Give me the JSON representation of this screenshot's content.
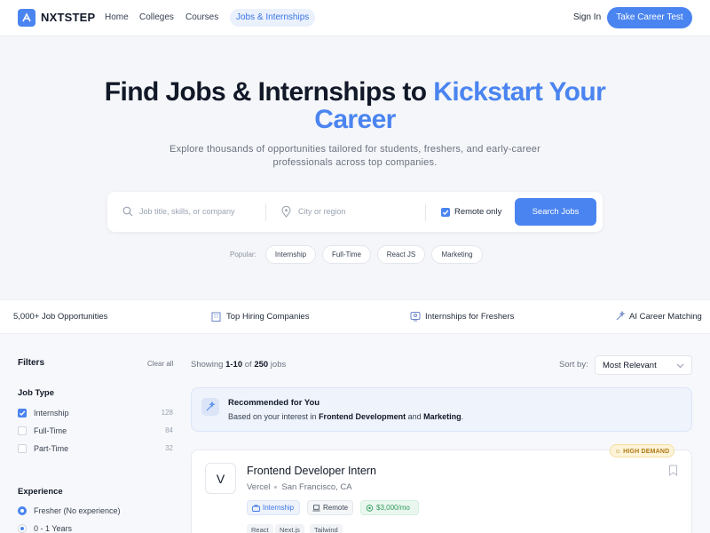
{
  "nav": {
    "brand": "NXTSTEP",
    "links": [
      "Home",
      "Colleges",
      "Courses",
      "Jobs & Internships"
    ],
    "active_link": "Jobs & Internships",
    "signin": "Sign In",
    "cta": "Take Career Test",
    "accent_color": "#4a84f0"
  },
  "hero": {
    "title_part1": "Find Jobs & Internships to ",
    "title_accent_1": "Kickstart Your",
    "title_accent_2": "Career",
    "subtitle": "Explore thousands of opportunities tailored for students, freshers, and early-career professionals across top companies."
  },
  "search": {
    "job_placeholder": "Job title, skills, or company",
    "location_placeholder": "City or region",
    "remote_label": "Remote only",
    "remote_checked": true,
    "button": "Search Jobs",
    "popular_label": "Popular:",
    "popular_tags": [
      "Internship",
      "Full-Time",
      "React JS",
      "Marketing"
    ]
  },
  "features": [
    {
      "label": "5,000+ Job Opportunities",
      "icon": "briefcase-icon"
    },
    {
      "label": "Top Hiring Companies",
      "icon": "building-icon"
    },
    {
      "label": "Internships for Freshers",
      "icon": "id-card-icon"
    },
    {
      "label": "AI Career Matching",
      "icon": "sparkle-icon"
    }
  ],
  "filters": {
    "title": "Filters",
    "clear": "Clear all",
    "job_type_title": "Job Type",
    "job_types": [
      {
        "label": "Internship",
        "count": "128",
        "checked": true
      },
      {
        "label": "Full-Time",
        "count": "84",
        "checked": false
      },
      {
        "label": "Part-Time",
        "count": "32",
        "checked": false
      }
    ],
    "experience_title": "Experience",
    "experience": [
      {
        "label": "Fresher (No experience)",
        "selected": true
      },
      {
        "label": "0 - 1 Years",
        "selected": false
      }
    ]
  },
  "results": {
    "showing_prefix": "Showing ",
    "showing_range": "1-10",
    "showing_middle": " of ",
    "showing_total": "250",
    "showing_suffix": " jobs",
    "sort_label": "Sort by:",
    "sort_value": "Most Relevant"
  },
  "recommendation": {
    "title": "Recommended for You",
    "text_prefix": "Based on your interest in ",
    "interest_1": "Frontend Development",
    "text_middle": " and ",
    "interest_2": "Marketing",
    "text_suffix": "."
  },
  "job_card": {
    "badge": "HIGH DEMAND",
    "logo_letter": "V",
    "title": "Frontend Developer Intern",
    "company": "Vercel",
    "location": "San Francisco, CA",
    "tags": {
      "type": "Internship",
      "mode": "Remote",
      "salary": "$3,000/mo"
    },
    "skills": [
      "React",
      "Next.js",
      "Tailwind"
    ]
  }
}
